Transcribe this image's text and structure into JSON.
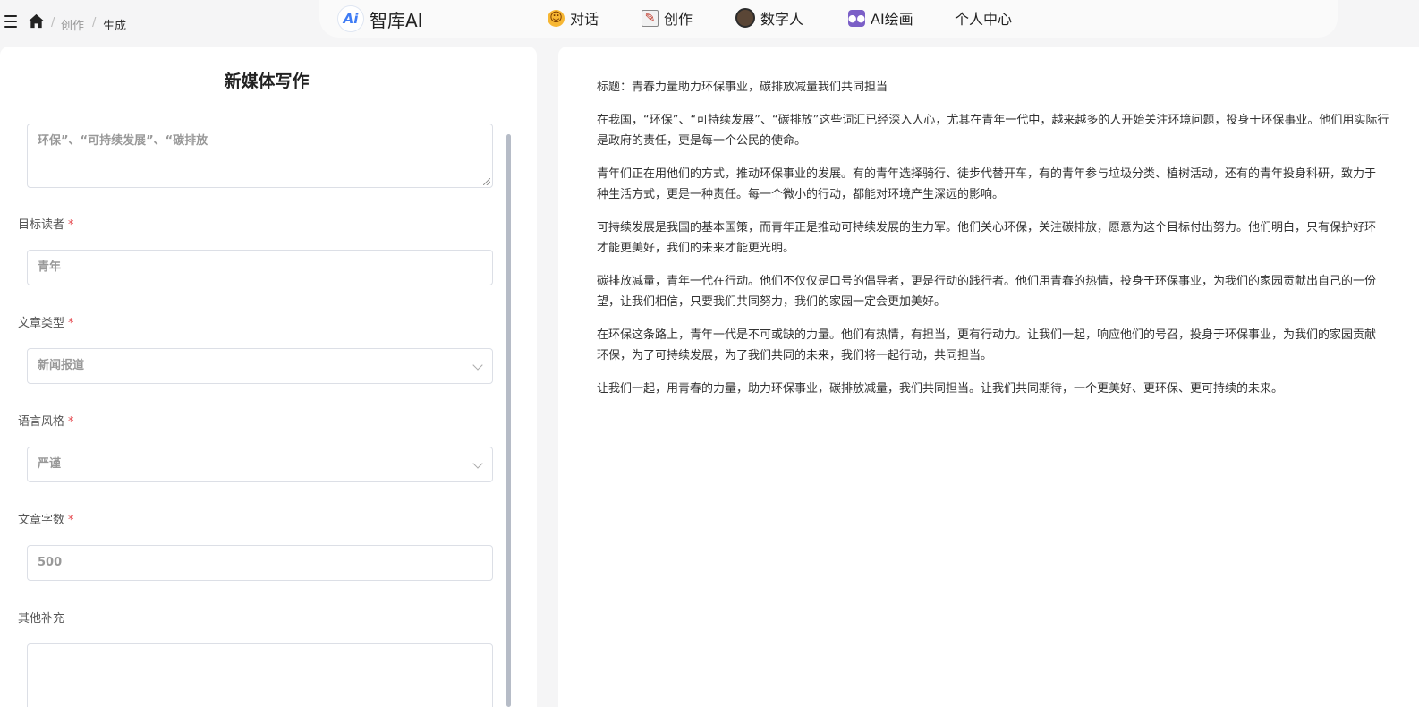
{
  "breadcrumb": {
    "home_icon": "home-icon",
    "items": [
      "创作",
      "生成"
    ],
    "separator": "/"
  },
  "navbar": {
    "brand": {
      "logo_text": "Ai",
      "name": "智库AI"
    },
    "items": [
      {
        "label": "对话",
        "icon": "smiley-emoji-icon"
      },
      {
        "label": "创作",
        "icon": "memo-emoji-icon"
      },
      {
        "label": "数字人",
        "icon": "avatar-face-icon"
      },
      {
        "label": "AI绘画",
        "icon": "alien-monster-icon"
      },
      {
        "label": "个人中心",
        "icon": ""
      }
    ]
  },
  "form": {
    "title": "新媒体写作",
    "keywords_value": "环保”、“可持续发展”、“碳排放",
    "target_reader": {
      "label": "目标读者",
      "value": "青年"
    },
    "article_type": {
      "label": "文章类型",
      "value": "新闻报道"
    },
    "language_style": {
      "label": "语言风格",
      "value": "严谨"
    },
    "word_count": {
      "label": "文章字数",
      "value": "500"
    },
    "other": {
      "label": "其他补充",
      "value": ""
    },
    "required_mark": "*"
  },
  "article": {
    "paragraphs": [
      "标题：青春力量助力环保事业，碳排放减量我们共同担当",
      "在我国，“环保”、“可持续发展”、“碳排放”这些词汇已经深入人心，尤其在青年一代中，越来越多的人开始关注环境问题，投身于环保事业。他们用实际行",
      "是政府的责任，更是每一个公民的使命。",
      "青年们正在用他们的方式，推动环保事业的发展。有的青年选择骑行、徒步代替开车，有的青年参与垃圾分类、植树活动，还有的青年投身科研，致力于",
      "种生活方式，更是一种责任。每一个微小的行动，都能对环境产生深远的影响。",
      "可持续发展是我国的基本国策，而青年正是推动可持续发展的生力军。他们关心环保，关注碳排放，愿意为这个目标付出努力。他们明白，只有保护好环",
      "才能更美好，我们的未来才能更光明。",
      "碳排放减量，青年一代在行动。他们不仅仅是口号的倡导者，更是行动的践行者。他们用青春的热情，投身于环保事业，为我们的家园贡献出自己的一份",
      "望，让我们相信，只要我们共同努力，我们的家园一定会更加美好。",
      "在环保这条路上，青年一代是不可或缺的力量。他们有热情，有担当，更有行动力。让我们一起，响应他们的号召，投身于环保事业，为我们的家园贡献",
      "环保，为了可持续发展，为了我们共同的未来，我们将一起行动，共同担当。",
      "让我们一起，用青春的力量，助力环保事业，碳排放减量，我们共同担当。让我们共同期待，一个更美好、更环保、更可持续的未来。"
    ]
  },
  "colors": {
    "accent": "#3f7cf5",
    "required": "#e5484d",
    "background": "#f5f5f6"
  }
}
